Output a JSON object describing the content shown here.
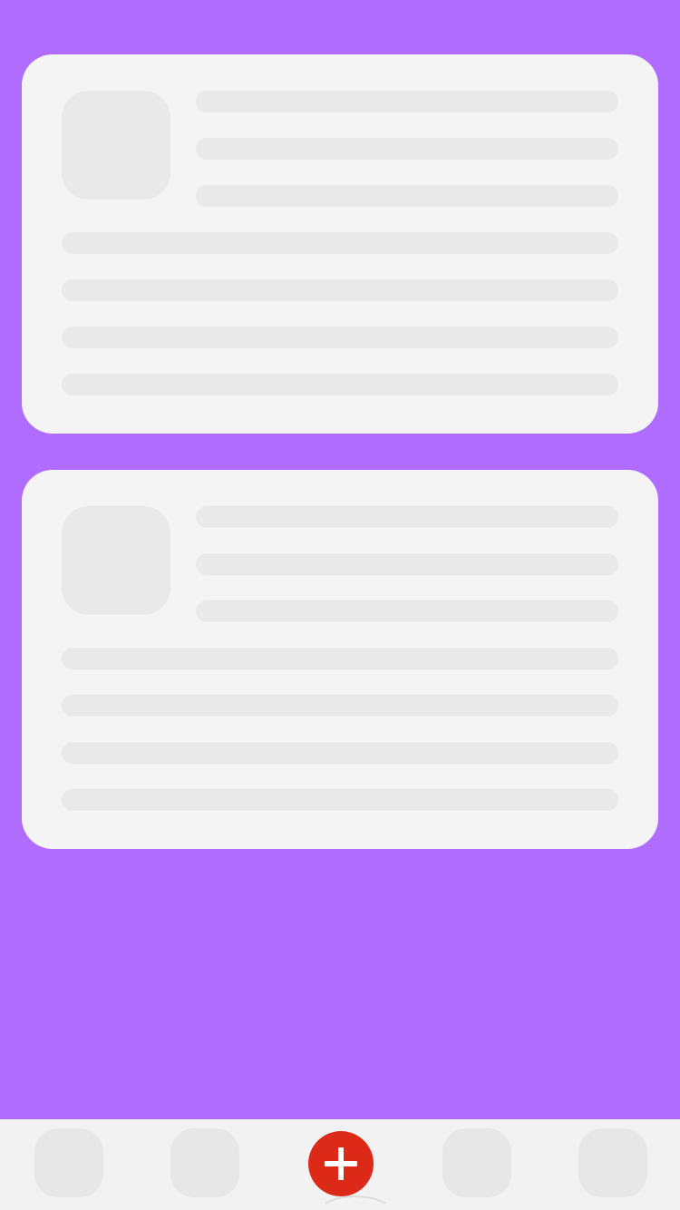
{
  "theme": {
    "background": "#b06cff",
    "card": "#f4f4f4",
    "skeleton": "#e9e9e9",
    "tabbar": "#f2f2f2",
    "accent": "#dd2a18"
  },
  "feed": {
    "cards": [
      {
        "state": "loading-placeholder"
      },
      {
        "state": "loading-placeholder"
      }
    ]
  },
  "tabbar": {
    "items": [
      {
        "icon": "tab-placeholder"
      },
      {
        "icon": "tab-placeholder"
      },
      {
        "icon": "plus-icon"
      },
      {
        "icon": "tab-placeholder"
      },
      {
        "icon": "tab-placeholder"
      }
    ]
  }
}
